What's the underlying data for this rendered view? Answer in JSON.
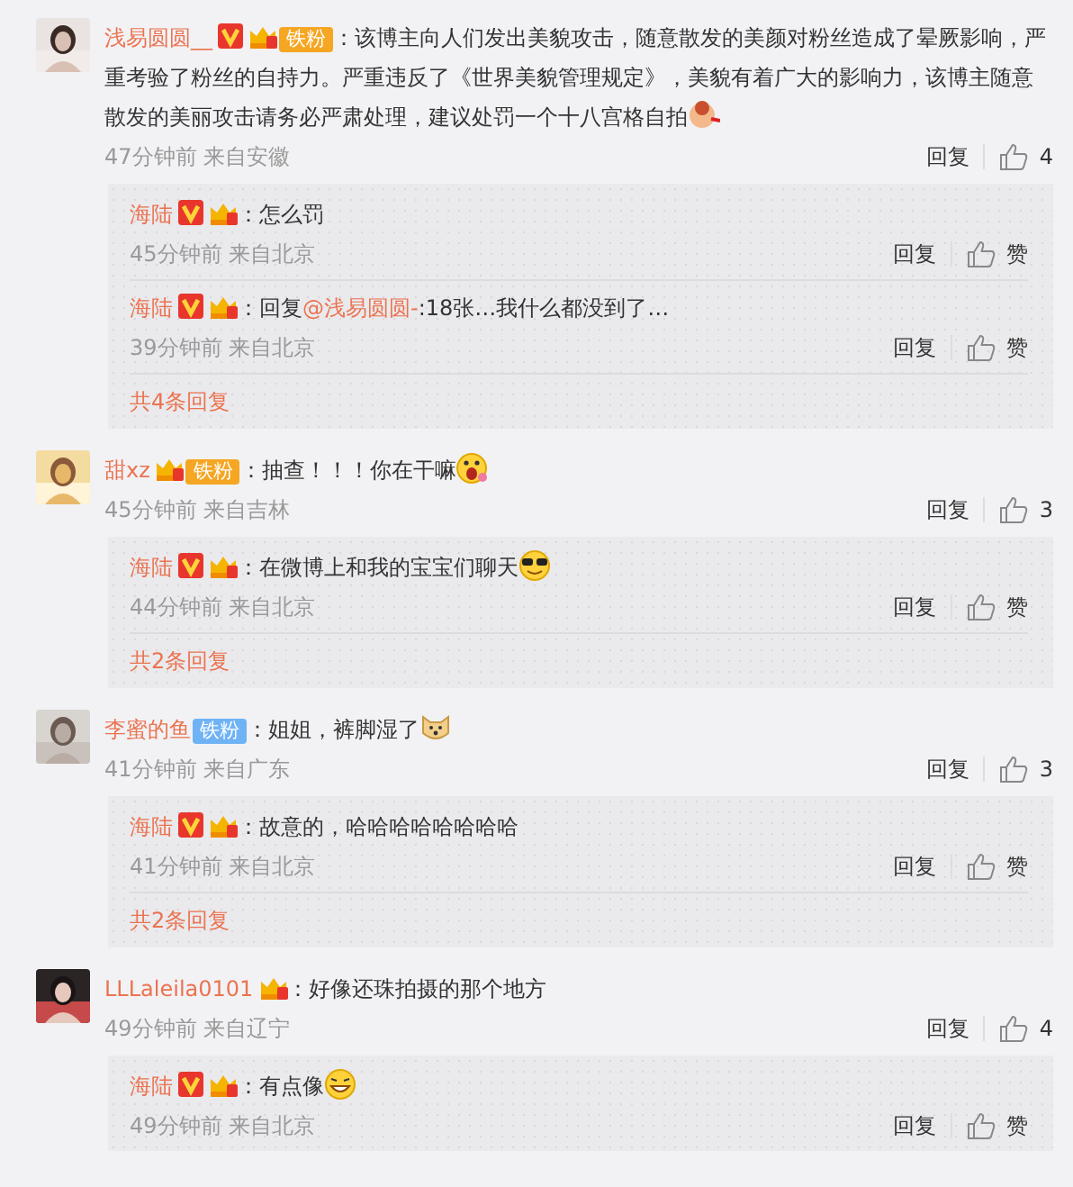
{
  "comments": [
    {
      "user": "浅易圆圆__",
      "badges": [
        {
          "kind": "verified"
        },
        {
          "kind": "crown"
        },
        {
          "kind": "fan",
          "label": "铁粉",
          "color": "#f5a623"
        }
      ],
      "text": "：该博主向人们发出美貌攻击，随意散发的美颜对粉丝造成了晕厥影响，严重考验了粉丝的自持力。严重违反了《世界美貌管理规定》，美貌有着广大的影响力，该博主随意散发的美丽攻击请务必严肃处理，建议处罚一个十八宫格自拍",
      "emoji": {
        "kind": "sticker"
      },
      "time": "47分钟前",
      "source": "来自安徽",
      "reply_label": "回复",
      "likes": "4",
      "replies": [
        {
          "user": "海陆",
          "badges": [
            {
              "kind": "verified"
            },
            {
              "kind": "crown"
            }
          ],
          "text": "：怎么罚",
          "time": "45分钟前",
          "source": "来自北京",
          "reply_label": "回复",
          "like_label": "赞"
        },
        {
          "user": "海陆",
          "badges": [
            {
              "kind": "verified"
            },
            {
              "kind": "crown"
            }
          ],
          "text": "：回复",
          "mention": "@浅易圆圆-",
          "after": ":18张…我什么都没到了…",
          "time": "39分钟前",
          "source": "来自北京",
          "reply_label": "回复",
          "like_label": "赞"
        }
      ],
      "more": "共4条回复"
    },
    {
      "user": "甜xz",
      "badges": [
        {
          "kind": "crown"
        },
        {
          "kind": "fan",
          "label": "铁粉",
          "color": "#f5a623"
        }
      ],
      "text": "：抽查！！！你在干嘛",
      "emoji": {
        "kind": "surprised"
      },
      "time": "45分钟前",
      "source": "来自吉林",
      "reply_label": "回复",
      "likes": "3",
      "replies": [
        {
          "user": "海陆",
          "badges": [
            {
              "kind": "verified"
            },
            {
              "kind": "crown"
            }
          ],
          "text": "：在微博上和我的宝宝们聊天",
          "emoji": {
            "kind": "cool"
          },
          "time": "44分钟前",
          "source": "来自北京",
          "reply_label": "回复",
          "like_label": "赞"
        }
      ],
      "more": "共2条回复"
    },
    {
      "user": "李蜜的鱼",
      "badges": [
        {
          "kind": "fan",
          "label": "铁粉",
          "color": "#6fb3f5"
        }
      ],
      "text": "：姐姐，裤脚湿了",
      "emoji": {
        "kind": "dog"
      },
      "time": "41分钟前",
      "source": "来自广东",
      "reply_label": "回复",
      "likes": "3",
      "replies": [
        {
          "user": "海陆",
          "badges": [
            {
              "kind": "verified"
            },
            {
              "kind": "crown"
            }
          ],
          "text": "：故意的，哈哈哈哈哈哈哈哈",
          "time": "41分钟前",
          "source": "来自北京",
          "reply_label": "回复",
          "like_label": "赞"
        }
      ],
      "more": "共2条回复"
    },
    {
      "user": "LLLaleila0101",
      "badges": [
        {
          "kind": "crown"
        }
      ],
      "text": "：好像还珠拍摄的那个地方",
      "time": "49分钟前",
      "source": "来自辽宁",
      "reply_label": "回复",
      "likes": "4",
      "replies": [
        {
          "user": "海陆",
          "badges": [
            {
              "kind": "verified"
            },
            {
              "kind": "crown"
            }
          ],
          "text": "：有点像",
          "emoji": {
            "kind": "grin"
          },
          "time": "49分钟前",
          "source": "来自北京",
          "reply_label": "回复",
          "like_label": "赞"
        }
      ]
    }
  ]
}
